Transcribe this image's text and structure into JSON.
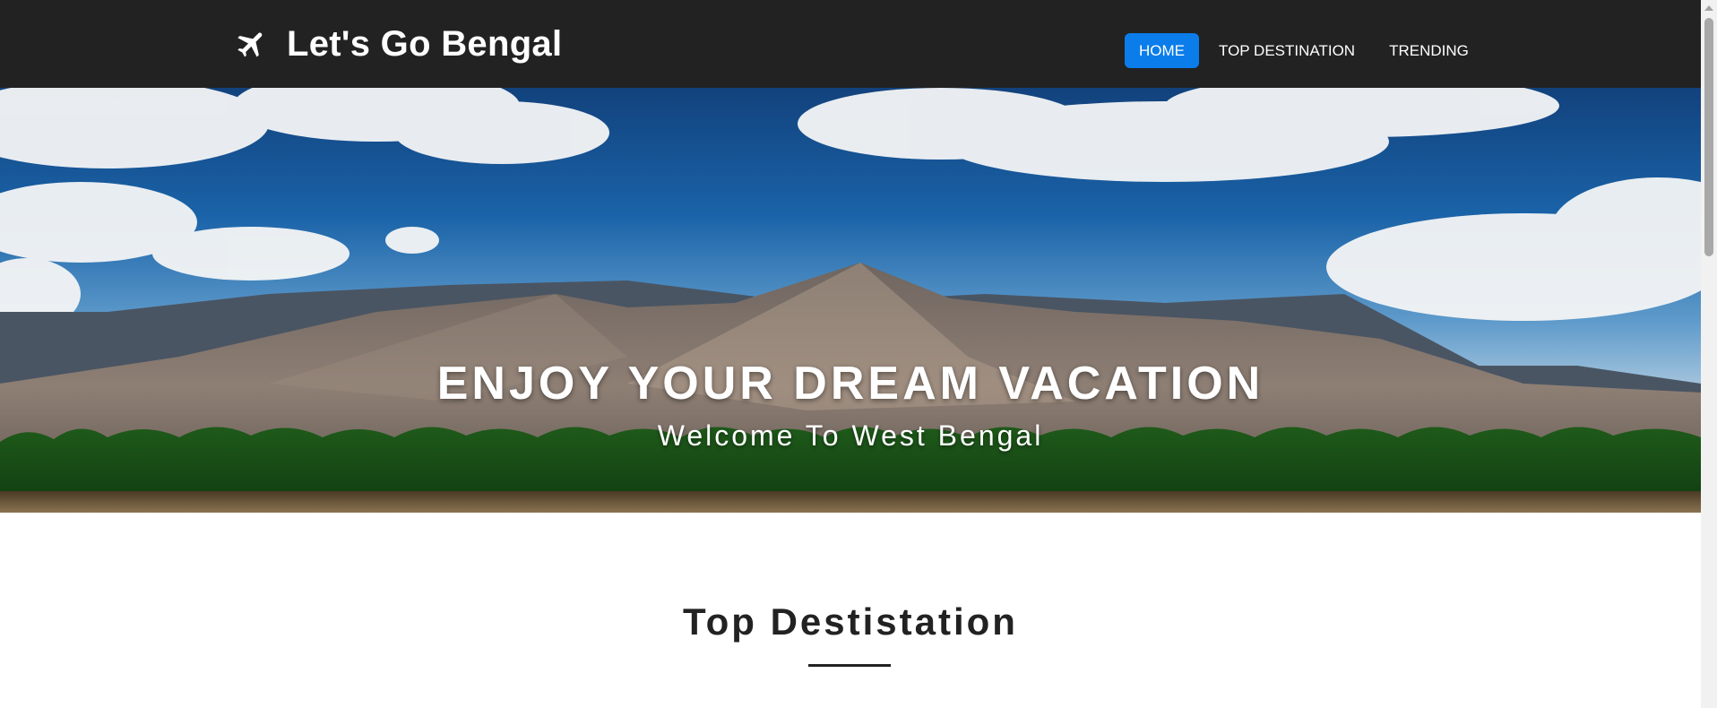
{
  "brand": {
    "name": "Let's Go Bengal",
    "icon": "airplane-icon"
  },
  "nav": {
    "items": [
      {
        "label": "HOME",
        "active": true
      },
      {
        "label": "TOP DESTINATION",
        "active": false
      },
      {
        "label": "TRENDING",
        "active": false
      }
    ]
  },
  "hero": {
    "title": "ENJOY YOUR DREAM VACATION",
    "subtitle": "Welcome To West Bengal"
  },
  "section": {
    "title": "Top Destistation"
  },
  "colors": {
    "navbar_bg": "#222222",
    "active_nav_bg": "#0b7dea",
    "text_dark": "#222222"
  }
}
